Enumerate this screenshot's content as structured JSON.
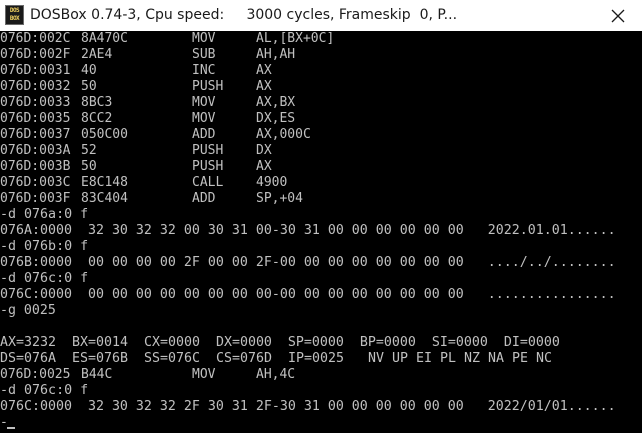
{
  "window": {
    "icon_top": "DOS",
    "icon_bottom": "BOX",
    "title": "DOSBox 0.74-3, Cpu speed:     3000 cycles, Frameskip  0, P..."
  },
  "console": {
    "disassembly": [
      {
        "addr": "076D:002C",
        "bytes": "8A470C",
        "op": "MOV",
        "args": "AL,[BX+0C]"
      },
      {
        "addr": "076D:002F",
        "bytes": "2AE4",
        "op": "SUB",
        "args": "AH,AH"
      },
      {
        "addr": "076D:0031",
        "bytes": "40",
        "op": "INC",
        "args": "AX"
      },
      {
        "addr": "076D:0032",
        "bytes": "50",
        "op": "PUSH",
        "args": "AX"
      },
      {
        "addr": "076D:0033",
        "bytes": "8BC3",
        "op": "MOV",
        "args": "AX,BX"
      },
      {
        "addr": "076D:0035",
        "bytes": "8CC2",
        "op": "MOV",
        "args": "DX,ES"
      },
      {
        "addr": "076D:0037",
        "bytes": "050C00",
        "op": "ADD",
        "args": "AX,000C"
      },
      {
        "addr": "076D:003A",
        "bytes": "52",
        "op": "PUSH",
        "args": "DX"
      },
      {
        "addr": "076D:003B",
        "bytes": "50",
        "op": "PUSH",
        "args": "AX"
      },
      {
        "addr": "076D:003C",
        "bytes": "E8C148",
        "op": "CALL",
        "args": "4900"
      },
      {
        "addr": "076D:003F",
        "bytes": "83C404",
        "op": "ADD",
        "args": "SP,+04"
      }
    ],
    "cmd_d_076a": "-d 076a:0 f",
    "dump_076a": "076A:0000  32 30 32 32 00 30 31 00-30 31 00 00 00 00 00 00   2022.01.01......",
    "cmd_d_076b": "-d 076b:0 f",
    "dump_076b": "076B:0000  00 00 00 00 2F 00 00 2F-00 00 00 00 00 00 00 00   ..../../........",
    "cmd_d_076c_1": "-d 076c:0 f",
    "dump_076c_1": "076C:0000  00 00 00 00 00 00 00 00-00 00 00 00 00 00 00 00   ................",
    "cmd_g": "-g 0025",
    "blank": "",
    "regs_1": "AX=3232  BX=0014  CX=0000  DX=0000  SP=0000  BP=0000  SI=0000  DI=0000",
    "regs_2": "DS=076A  ES=076B  SS=076C  CS=076D  IP=0025   NV UP EI PL NZ NA PE NC",
    "last_instr": {
      "addr": "076D:0025",
      "bytes": "B44C",
      "op": "MOV",
      "args": "AH,4C"
    },
    "cmd_d_076c_2": "-d 076c:0 f",
    "dump_076c_2": "076C:0000  32 30 32 32 2F 30 31 2F-30 31 00 00 00 00 00 00   2022/01/01......",
    "prompt": "-"
  },
  "colors": {
    "text": "#c0c0c0",
    "background": "#000000",
    "titlebar": "#ffffff"
  },
  "icons": {
    "close": "close-icon",
    "app": "dosbox-app-icon"
  }
}
